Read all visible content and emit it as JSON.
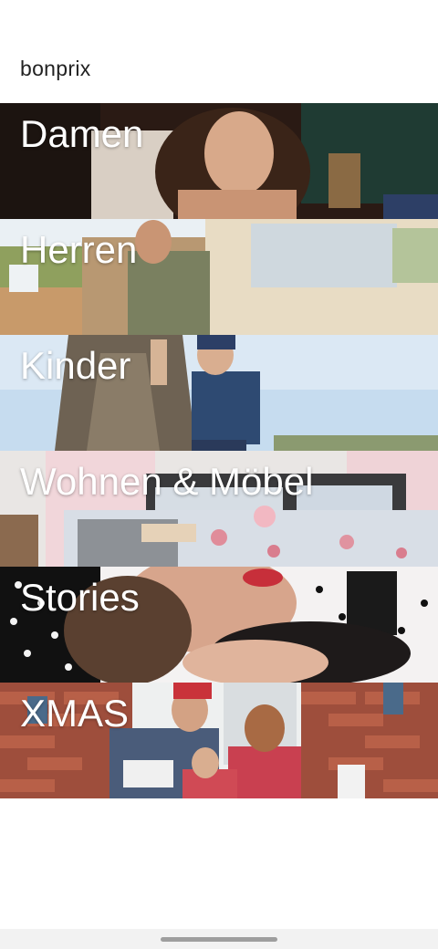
{
  "app": {
    "title": "bonprix"
  },
  "categories": [
    {
      "label": "Damen",
      "image": "woman-portrait-photo"
    },
    {
      "label": "Herren",
      "image": "man-in-hoodie-by-car-photo"
    },
    {
      "label": "Kinder",
      "image": "boy-by-tree-photo"
    },
    {
      "label": "Wohnen & Möbel",
      "image": "bedroom-floral-bedding-photo"
    },
    {
      "label": "Stories",
      "image": "two-women-laughing-photo"
    },
    {
      "label": "XMAS",
      "image": "family-christmas-photo"
    }
  ],
  "navigation": {
    "home_indicator": "home-gesture-bar"
  }
}
